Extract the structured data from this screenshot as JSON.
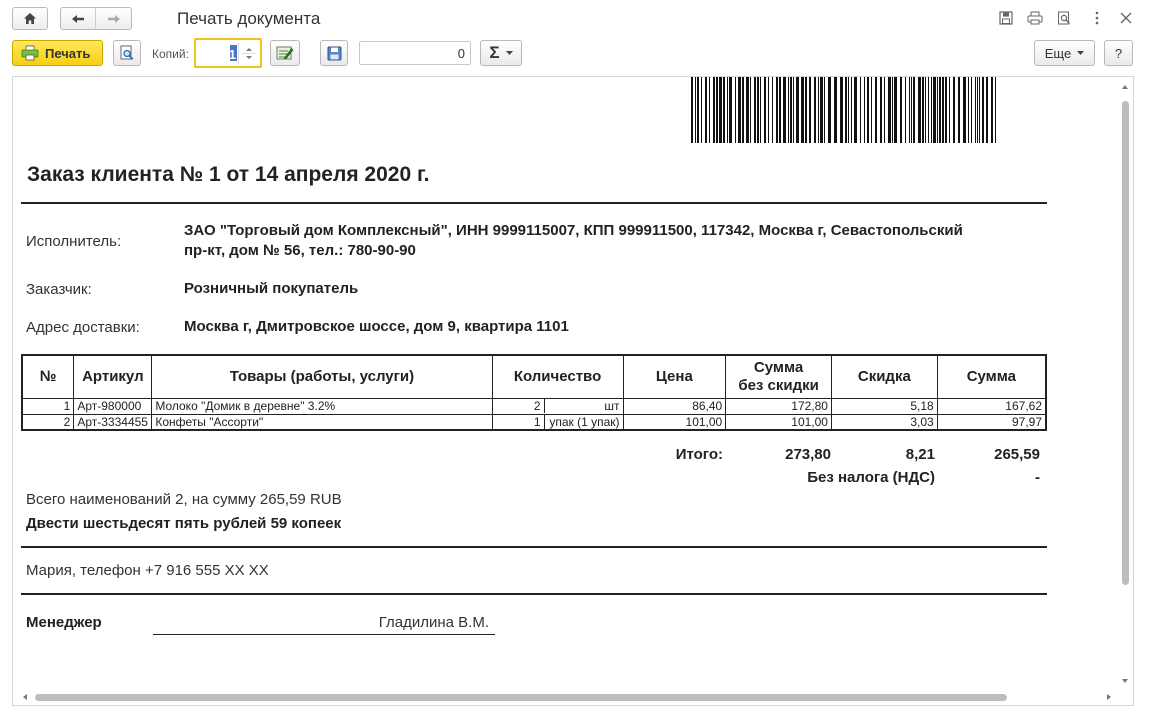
{
  "window": {
    "title": "Печать документа"
  },
  "toolbar": {
    "print_label": "Печать",
    "copies_label": "Копий:",
    "copies_value": "1",
    "sum_value": "0",
    "sigma_label": "Σ",
    "more_label": "Еще",
    "help_label": "?"
  },
  "document": {
    "title": "Заказ клиента № 1 от 14 апреля 2020 г.",
    "executor_label": "Исполнитель:",
    "executor_line1": "ЗАО \"Торговый дом Комплексный\", ИНН 9999115007, КПП 999911500, 117342, Москва г, Севастопольский",
    "executor_line2": "пр-кт, дом № 56, тел.: 780-90-90",
    "customer_label": "Заказчик:",
    "customer_value": "Розничный покупатель",
    "address_label": "Адрес доставки:",
    "address_value": "Москва г, Дмитровское шоссе, дом 9, квартира 1101",
    "table": {
      "headers": {
        "num": "№",
        "article": "Артикул",
        "goods": "Товары (работы, услуги)",
        "quantity": "Количество",
        "price": "Цена",
        "sum_no_disc_1": "Сумма",
        "sum_no_disc_2": "без скидки",
        "discount": "Скидка",
        "sum": "Сумма"
      },
      "rows": [
        {
          "num": "1",
          "article": "Арт-980000",
          "goods": "Молоко \"Домик в деревне\" 3.2%",
          "qty": "2",
          "unit": "шт",
          "price": "86,40",
          "sum_no_disc": "172,80",
          "discount": "5,18",
          "sum": "167,62"
        },
        {
          "num": "2",
          "article": "Арт-3334455",
          "goods": "Конфеты \"Ассорти\"",
          "qty": "1",
          "unit": "упак (1 упак)",
          "price": "101,00",
          "sum_no_disc": "101,00",
          "discount": "3,03",
          "sum": "97,97"
        }
      ]
    },
    "totals": {
      "label": "Итого:",
      "sum_no_disc": "273,80",
      "discount": "8,21",
      "sum": "265,59",
      "vat_label": "Без налога (НДС)",
      "vat_value": "-"
    },
    "summary_line": "Всего наименований 2, на сумму 265,59 RUB",
    "amount_words": "Двести шестьдесят пять рублей 59 копеек",
    "contact": "Мария, телефон +7 916 555 XX XX",
    "manager_label": "Менеджер",
    "manager_name": "Гладилина В.М."
  },
  "icons": {
    "home": "home-icon",
    "back": "arrow-left-icon",
    "forward": "arrow-right-icon",
    "save": "save-icon",
    "print": "printer-icon",
    "preview": "preview-icon",
    "more_vert": "more-vertical-icon",
    "close": "close-icon",
    "edit": "edit-document-icon"
  },
  "colors": {
    "print_button": "#f6cf10",
    "copies_border": "#f0c41c",
    "text": "#333333"
  }
}
